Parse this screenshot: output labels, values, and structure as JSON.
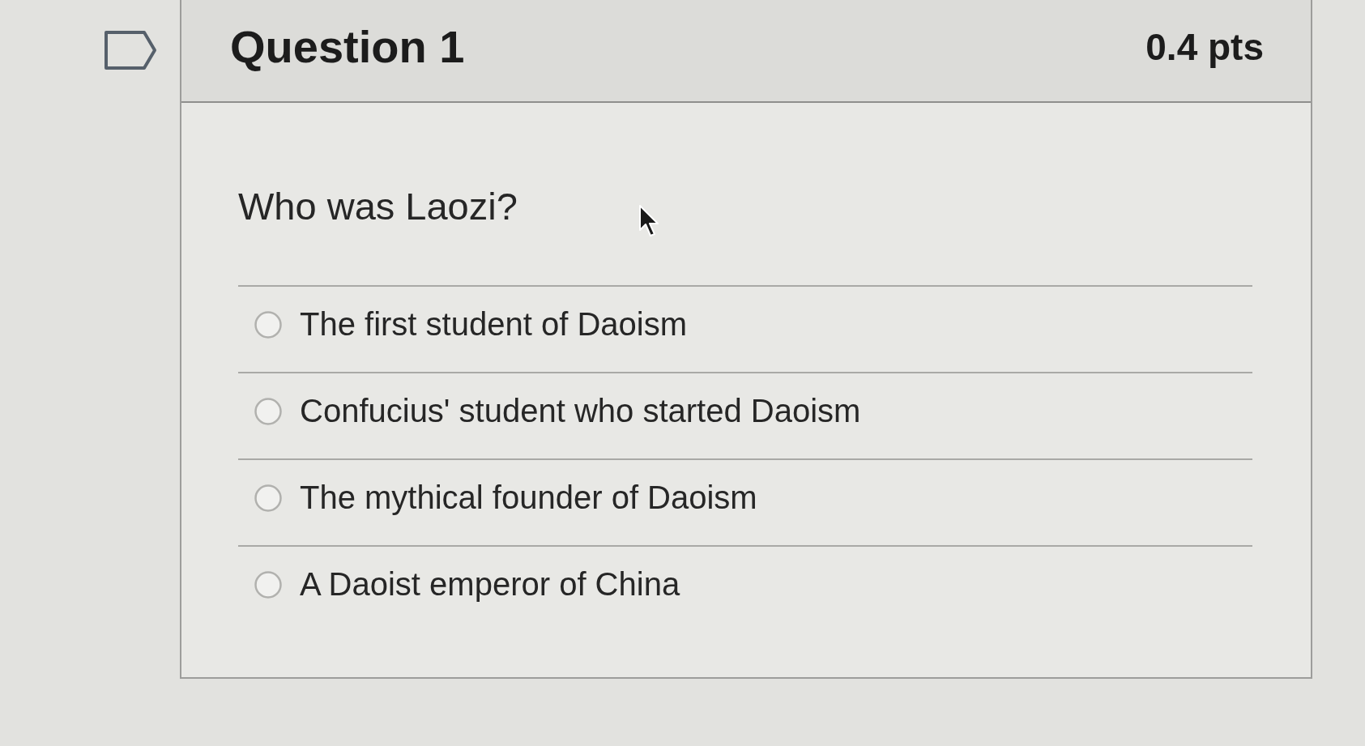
{
  "question": {
    "title": "Question 1",
    "points": "0.4 pts",
    "flagged": false,
    "text": "Who was Laozi?",
    "answers": [
      {
        "label": "The first student of Daoism",
        "selected": false
      },
      {
        "label": "Confucius' student who started Daoism",
        "selected": false
      },
      {
        "label": "The mythical founder of Daoism",
        "selected": false
      },
      {
        "label": "A Daoist emperor of China",
        "selected": false
      }
    ]
  }
}
